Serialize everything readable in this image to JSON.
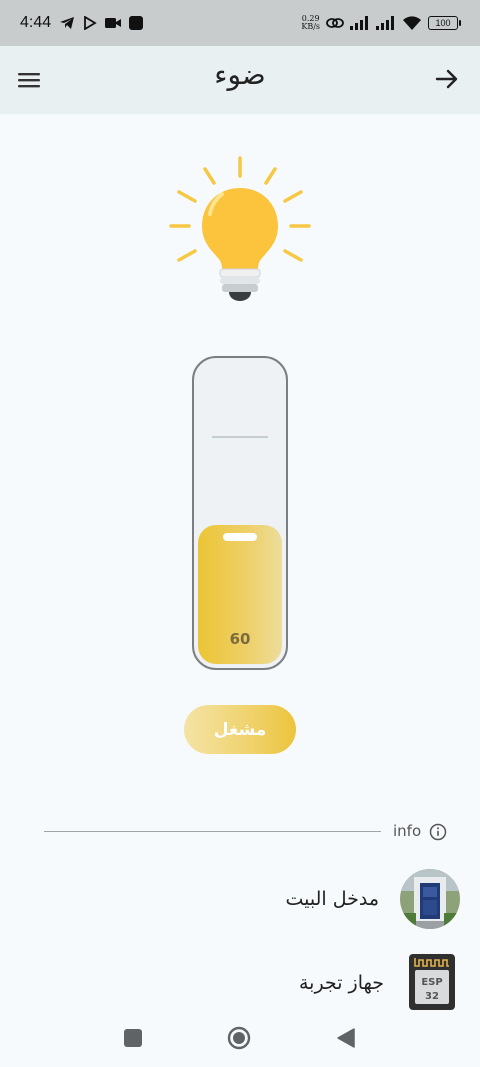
{
  "status_bar": {
    "time": "4:44",
    "speed_value": "0.29",
    "speed_unit": "KB/s",
    "battery": "100"
  },
  "app_bar": {
    "title": "ضوء",
    "menu_icon": "hamburger-menu-icon",
    "back_icon": "arrow-right-icon"
  },
  "light": {
    "icon": "light-bulb-icon",
    "brightness": 60,
    "brightness_max": 100,
    "toggle_label": "مشغل",
    "accent_color": "#ecc43c"
  },
  "info_section": {
    "label": "info",
    "icon": "info-circle-icon"
  },
  "devices": [
    {
      "name": "مدخل البيت",
      "icon": "front-door-photo"
    },
    {
      "name": "جهاز تجربة",
      "icon": "esp32-chip-icon",
      "chip_text_top": "ESP",
      "chip_text_bottom": "32"
    }
  ]
}
